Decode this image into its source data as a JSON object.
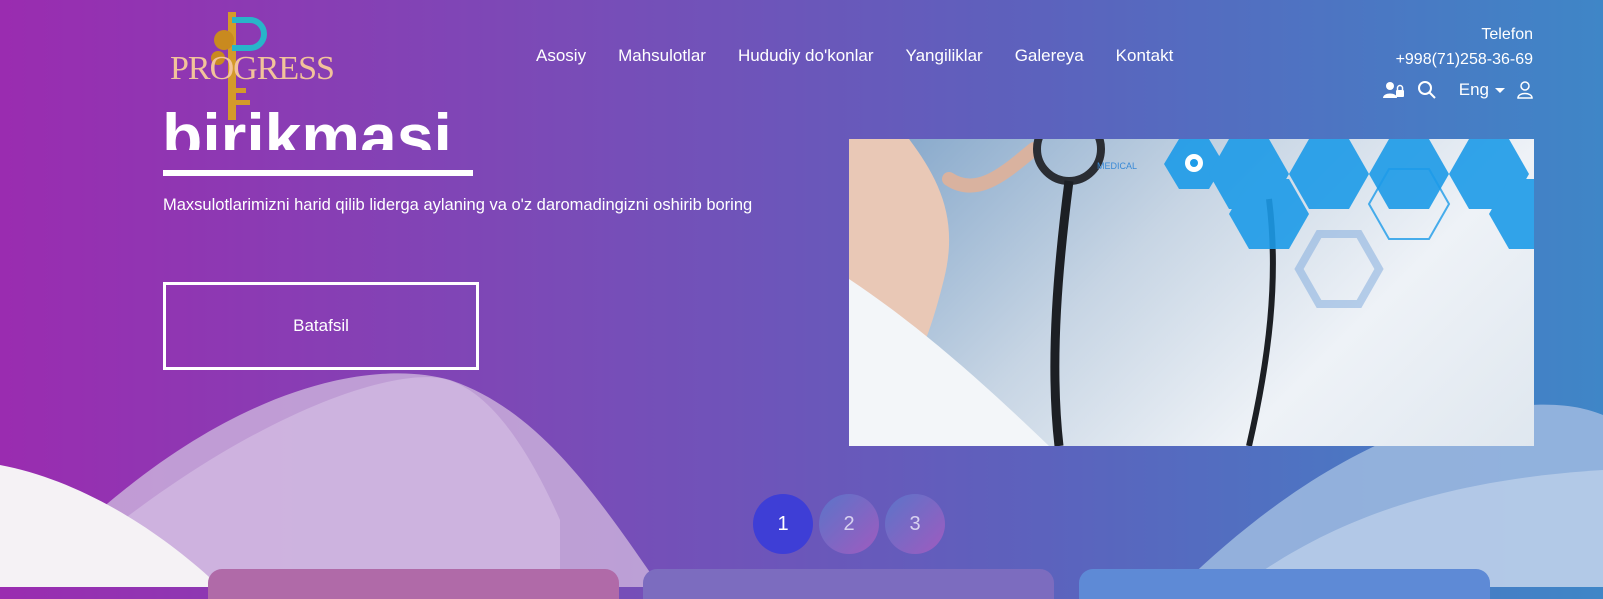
{
  "brand": {
    "logo_text": "PROGRESS"
  },
  "nav": {
    "items": [
      "Asosiy",
      "Mahsulotlar",
      "Hududiy do'konlar",
      "Yangiliklar",
      "Galereya",
      "Kontakt"
    ]
  },
  "contact": {
    "label": "Telefon",
    "phone": "+998(71)258-36-69"
  },
  "tools": {
    "icons": [
      "user-lock-icon",
      "search-icon",
      "user-icon"
    ],
    "language": "Eng"
  },
  "hero": {
    "title": "birikmasi",
    "subtitle": "Maxsulotlarimizni harid qilib liderga aylaning va o'z daromadingizni oshirib boring",
    "cta_label": "Batafsil",
    "image_labels": [
      "MEDICAL"
    ]
  },
  "slider": {
    "pages": [
      "1",
      "2",
      "3"
    ],
    "active": "1"
  },
  "colors": {
    "gradient_start": "#9a2cb0",
    "gradient_end": "#3f86c7",
    "active_dot": "#3e3ed6",
    "card_1": "#b06aa8",
    "card_2": "#7c6cbf",
    "card_3": "#5e8ad6"
  }
}
